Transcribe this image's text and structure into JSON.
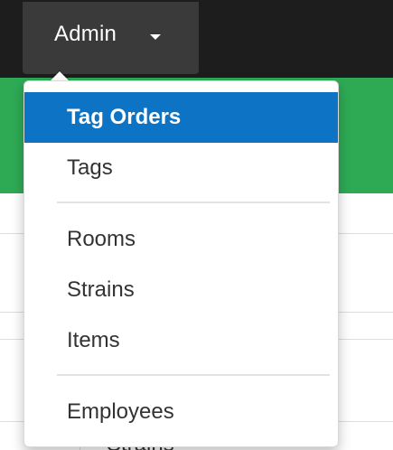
{
  "navbar": {
    "admin_label": "Admin",
    "caret_icon": "caret-down-icon"
  },
  "dropdown": {
    "groups": [
      {
        "items": [
          {
            "label": "Tag Orders",
            "active": true
          },
          {
            "label": "Tags",
            "active": false
          }
        ]
      },
      {
        "items": [
          {
            "label": "Rooms"
          },
          {
            "label": "Strains"
          },
          {
            "label": "Items"
          }
        ]
      },
      {
        "items": [
          {
            "label": "Employees"
          }
        ]
      }
    ]
  },
  "background": {
    "partial_text": "Strains"
  },
  "colors": {
    "navbar": "#1d1d1d",
    "nav_active": "#3a3a3a",
    "green": "#2eaa55",
    "highlight": "#0d74c5"
  }
}
